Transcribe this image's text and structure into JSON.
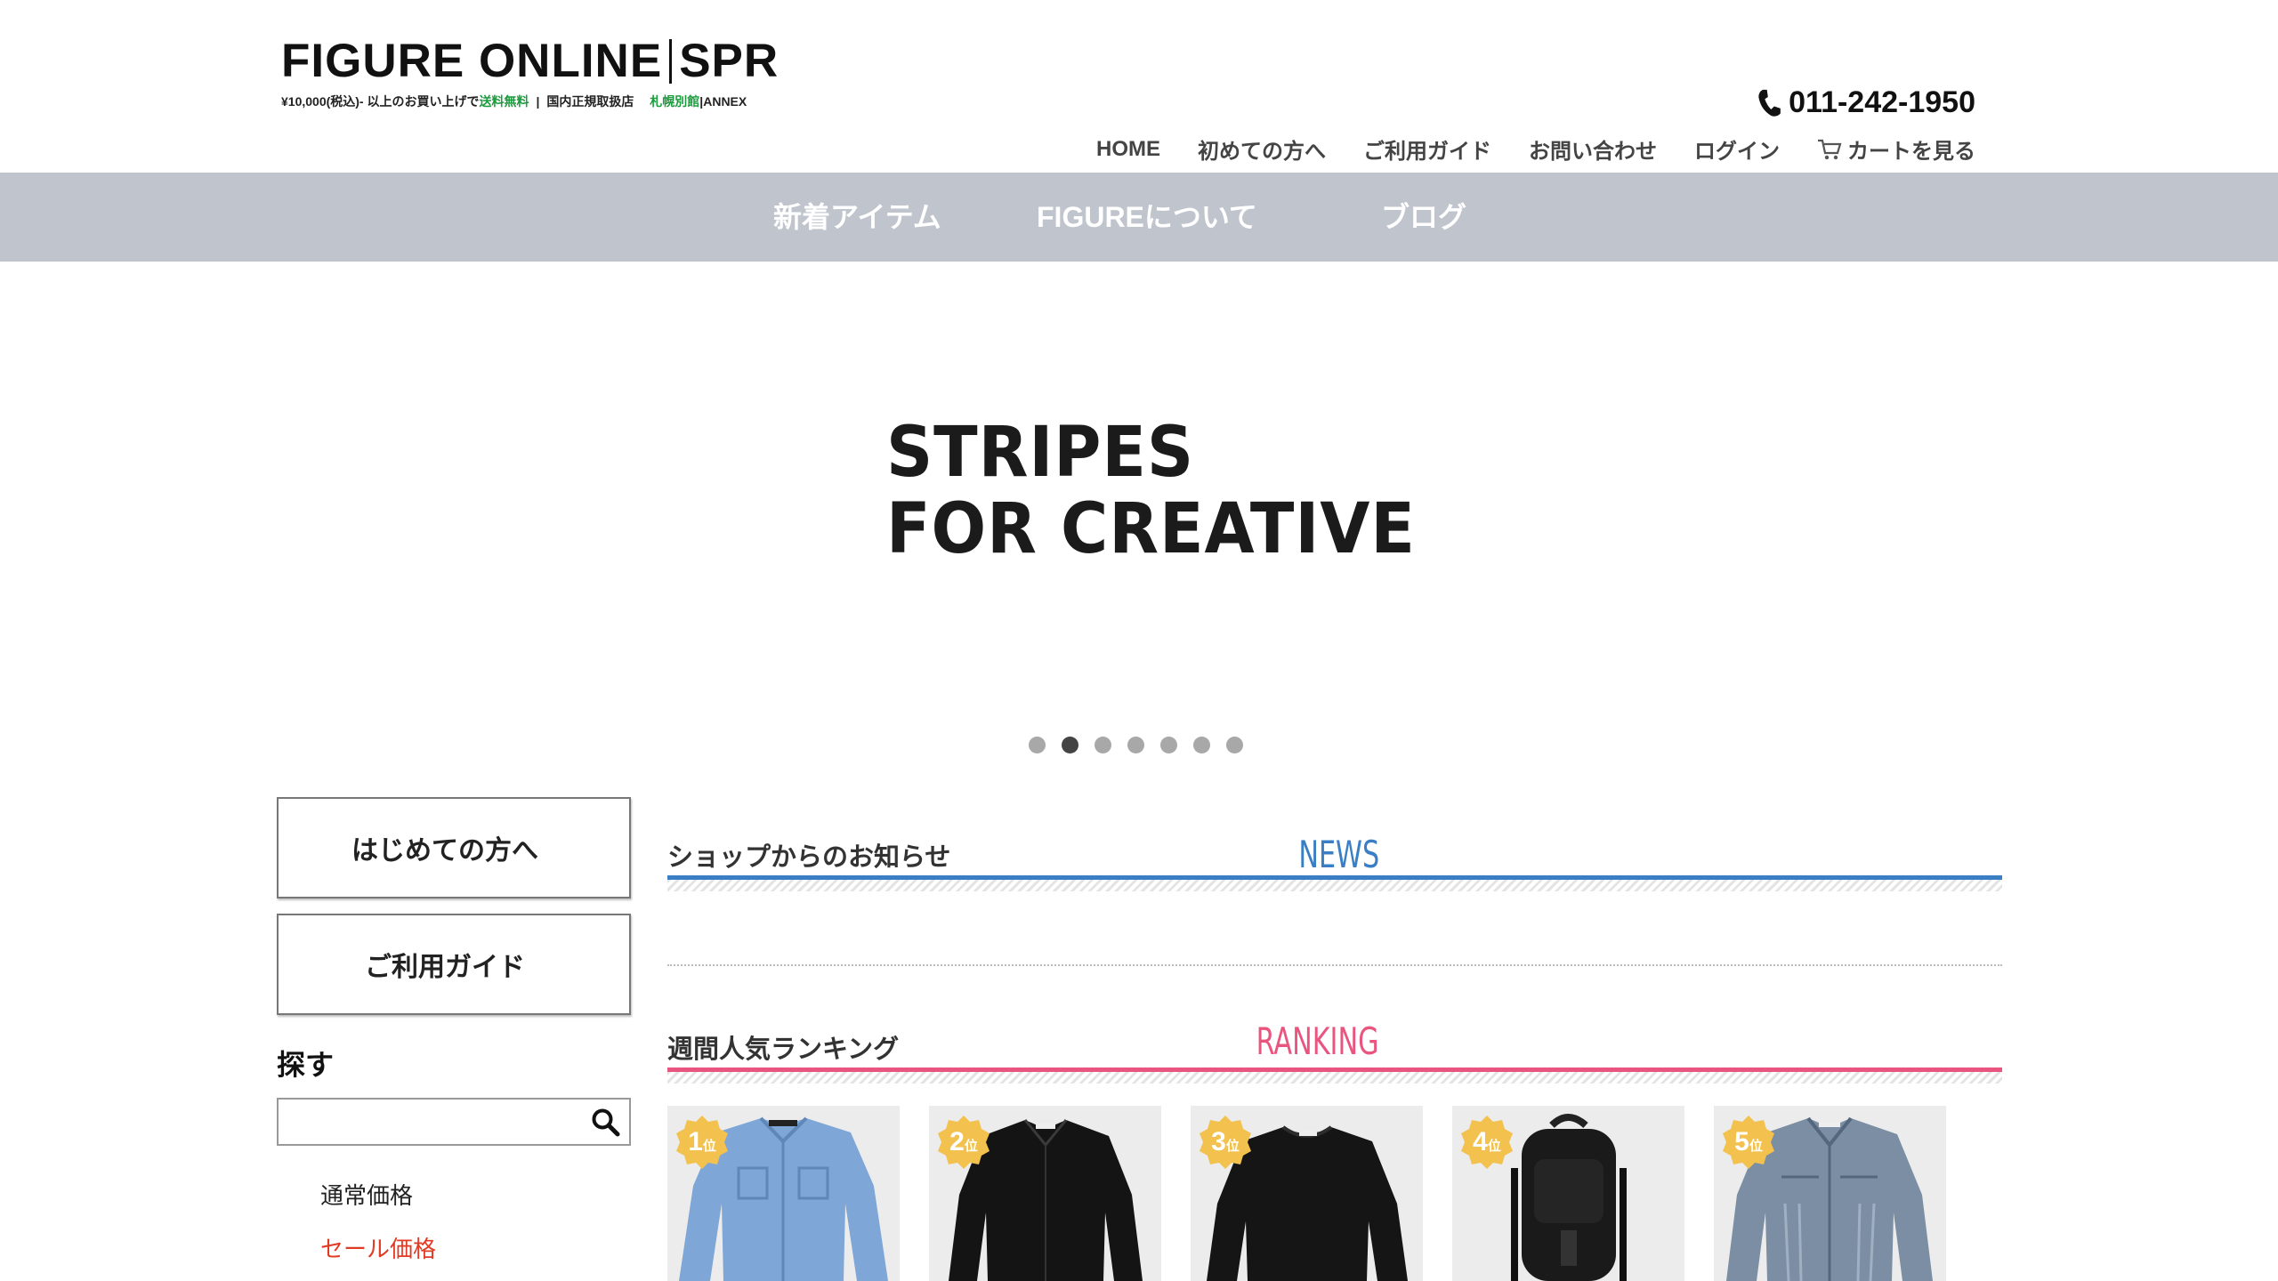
{
  "header": {
    "logo_main": "FIGURE ONLINE",
    "logo_suffix": "SPR",
    "tagline_prefix": "¥10,000(税込)- 以上のお買い上げで",
    "tagline_free": "送料無料",
    "tagline_divider": "|",
    "tagline_official": "国内正規取扱店",
    "tagline_annex_green": "札幌別館",
    "tagline_annex": "ANNEX",
    "phone": "011-242-1950",
    "nav": [
      {
        "label": "HOME"
      },
      {
        "label": "初めての方へ"
      },
      {
        "label": "ご利用ガイド"
      },
      {
        "label": "お問い合わせ"
      },
      {
        "label": "ログイン"
      },
      {
        "label": "カートを見る",
        "icon": "cart-icon"
      }
    ]
  },
  "category_bar": {
    "background": "#bfc4cd",
    "items": [
      {
        "label": "新着アイテム"
      },
      {
        "label": "FIGUREについて"
      },
      {
        "label": "ブログ"
      }
    ]
  },
  "hero": {
    "line1": "STRIPES",
    "line2": "FOR CREATIVE",
    "slide_count": 7,
    "active_slide": 2
  },
  "sidebar": {
    "first_time_button": "はじめての方へ",
    "guide_button": "ご利用ガイド",
    "find_label": "探す",
    "search_value": "",
    "search_icon": "search-icon",
    "price_links": [
      {
        "label": "通常価格",
        "color": "#222222"
      },
      {
        "label": "セール価格",
        "color": "#e03b24"
      }
    ]
  },
  "news": {
    "title": "ショップからのお知らせ",
    "label_en": "NEWS",
    "accent": "#3a7fc6"
  },
  "ranking": {
    "title": "週間人気ランキング",
    "label_en": "RANKING",
    "accent": "#e9557f",
    "medal_color": "#f2c14e",
    "items": [
      {
        "rank": "1",
        "suffix": "位",
        "product": "light blue chambray shirt"
      },
      {
        "rank": "2",
        "suffix": "位",
        "product": "black shirt"
      },
      {
        "rank": "3",
        "suffix": "位",
        "product": "black knit sweater"
      },
      {
        "rank": "4",
        "suffix": "位",
        "product": "black backpack"
      },
      {
        "rank": "5",
        "suffix": "位",
        "product": "washed denim jacket"
      }
    ]
  }
}
